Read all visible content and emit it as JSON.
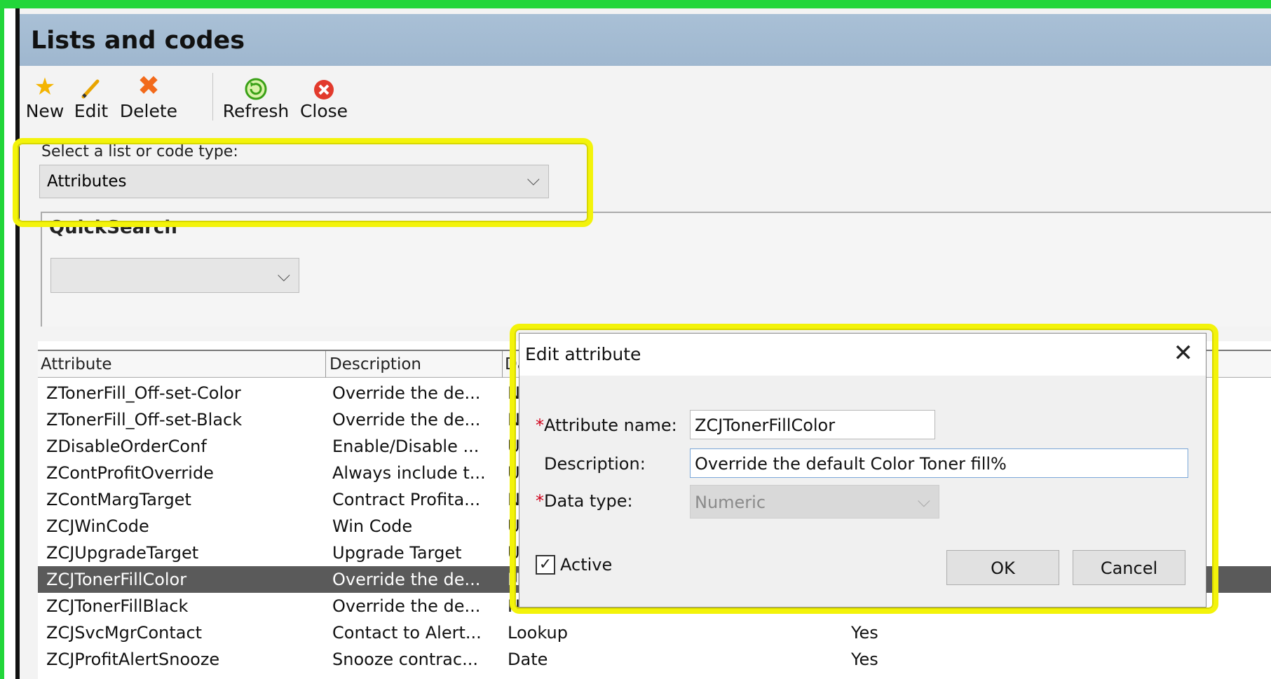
{
  "window": {
    "title": "Lists and codes"
  },
  "toolbar": {
    "new_label": "New",
    "edit_label": "Edit",
    "delete_label": "Delete",
    "refresh_label": "Refresh",
    "close_label": "Close"
  },
  "list_type": {
    "label": "Select a list or code type:",
    "value": "Attributes"
  },
  "quicksearch": {
    "title": "QuickSearch",
    "value": ""
  },
  "grid": {
    "headers": {
      "attribute": "Attribute",
      "description": "Description",
      "datatype": "Da"
    },
    "rows": [
      {
        "attribute": "ZTonerFill_Off-set-Color",
        "description": "Override the de...",
        "datatype": "N",
        "active": ""
      },
      {
        "attribute": "ZTonerFill_Off-set-Black",
        "description": "Override the de...",
        "datatype": "N",
        "active": ""
      },
      {
        "attribute": "ZDisableOrderConf",
        "description": "Enable/Disable ...",
        "datatype": "U",
        "active": ""
      },
      {
        "attribute": "ZContProfitOverride",
        "description": "Always include t...",
        "datatype": "U",
        "active": ""
      },
      {
        "attribute": "ZContMargTarget",
        "description": "Contract Profita...",
        "datatype": "N",
        "active": ""
      },
      {
        "attribute": "ZCJWinCode",
        "description": "Win Code",
        "datatype": "U",
        "active": ""
      },
      {
        "attribute": "ZCJUpgradeTarget",
        "description": "Upgrade Target",
        "datatype": "U",
        "active": ""
      },
      {
        "attribute": "ZCJTonerFillColor",
        "description": "Override the de...",
        "datatype": "N",
        "active": ""
      },
      {
        "attribute": "ZCJTonerFillBlack",
        "description": "Override the de...",
        "datatype": "N",
        "active": ""
      },
      {
        "attribute": "ZCJSvcMgrContact",
        "description": "Contact to Alert...",
        "datatype": "Lookup",
        "active": "Yes"
      },
      {
        "attribute": "ZCJProfitAlertSnooze",
        "description": "Snooze contrac...",
        "datatype": "Date",
        "active": "Yes"
      }
    ]
  },
  "dialog": {
    "title": "Edit attribute",
    "name_label": "Attribute name:",
    "name_value": "ZCJTonerFillColor",
    "description_label": "Description:",
    "description_value": "Override the default Color Toner fill%",
    "datatype_label": "Data type:",
    "datatype_value": "Numeric",
    "active_label": "Active",
    "ok_label": "OK",
    "cancel_label": "Cancel",
    "required_mark": "*"
  }
}
